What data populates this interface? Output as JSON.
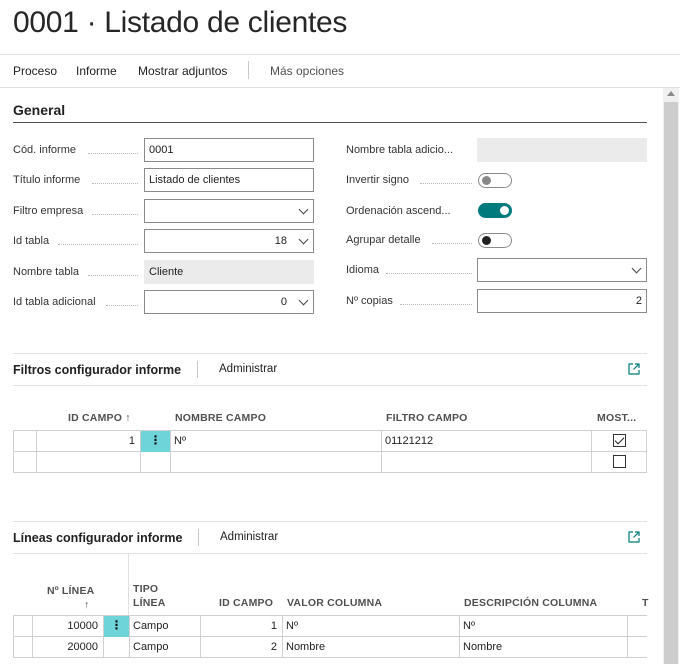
{
  "page": {
    "title": "0001 · Listado de clientes"
  },
  "actions": [
    {
      "label": "Proceso"
    },
    {
      "label": "Informe"
    },
    {
      "label": "Mostrar adjuntos"
    },
    {
      "label": "Más opciones"
    }
  ],
  "general": {
    "title": "General",
    "left": {
      "cod_informe": {
        "label": "Cód. informe",
        "value": "0001"
      },
      "titulo_informe": {
        "label": "Título informe",
        "value": "Listado de clientes"
      },
      "filtro_empresa": {
        "label": "Filtro empresa",
        "value": ""
      },
      "id_tabla": {
        "label": "Id tabla",
        "value": "18"
      },
      "nombre_tabla": {
        "label": "Nombre tabla",
        "value": "Cliente"
      },
      "id_tabla_adicional": {
        "label": "Id tabla adicional",
        "value": "0"
      }
    },
    "right": {
      "nombre_tabla_adicional": {
        "label": "Nombre tabla adicio...",
        "value": ""
      },
      "invertir_signo": {
        "label": "Invertir signo",
        "on": false
      },
      "ordenacion_ascend": {
        "label": "Ordenación ascend...",
        "on": true
      },
      "agrupar_detalle": {
        "label": "Agrupar detalle",
        "on": false
      },
      "idioma": {
        "label": "Idioma",
        "value": ""
      },
      "n_copias": {
        "label": "Nº copias",
        "value": "2"
      }
    }
  },
  "filtros": {
    "title": "Filtros configurador informe",
    "action": "Administrar",
    "columns": [
      "ID CAMPO ↑",
      "NOMBRE CAMPO",
      "FILTRO CAMPO",
      "MOST..."
    ],
    "rows": [
      {
        "id_campo": "1",
        "nombre_campo": "Nº",
        "filtro_campo": "01121212",
        "mostrar": true
      },
      {
        "id_campo": "",
        "nombre_campo": "",
        "filtro_campo": "",
        "mostrar": false
      }
    ]
  },
  "lineas": {
    "title": "Líneas configurador informe",
    "action": "Administrar",
    "columns": {
      "n_linea": "Nº LÍNEA",
      "n_linea_sort": "↑",
      "tipo_linea_1": "TIPO",
      "tipo_linea_2": "LÍNEA",
      "id_campo": "ID CAMPO",
      "valor_columna": "VALOR COLUMNA",
      "descripcion_columna": "DESCRIPCIÓN COLUMNA",
      "t": "T"
    },
    "rows": [
      {
        "n_linea": "10000",
        "tipo_linea": "Campo",
        "id_campo": "1",
        "valor_columna": "Nº",
        "descripcion_columna": "Nº"
      },
      {
        "n_linea": "20000",
        "tipo_linea": "Campo",
        "id_campo": "2",
        "valor_columna": "Nombre",
        "descripcion_columna": "Nombre"
      }
    ]
  },
  "icons": {
    "row_menu": "⋮",
    "expand": "expand-icon"
  },
  "colors": {
    "accent": "#007a7c",
    "row_selected": "#6fd3da"
  }
}
